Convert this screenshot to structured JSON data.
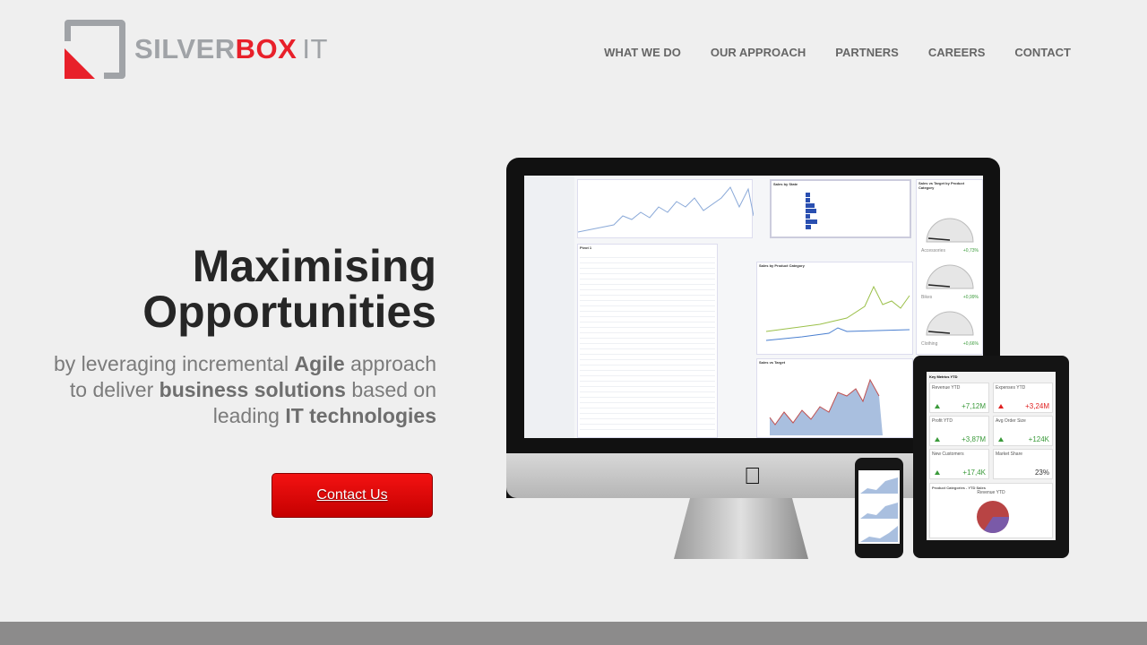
{
  "brand": {
    "name_a": "SILVER",
    "name_b": "BOX",
    "name_c": "IT",
    "accent": "#e8202a",
    "gray": "#a0a3a7"
  },
  "nav": [
    {
      "label": "WHAT WE DO"
    },
    {
      "label": "OUR APPROACH"
    },
    {
      "label": "PARTNERS"
    },
    {
      "label": "CAREERS"
    },
    {
      "label": "CONTACT"
    }
  ],
  "hero": {
    "title_1": "Maximising",
    "title_2": "Opportunities",
    "sub": [
      {
        "t": "by leveraging incremental ",
        "b": false
      },
      {
        "t": "Agile",
        "b": true
      },
      {
        "t": " approach to deliver ",
        "b": false
      },
      {
        "t": "business solutions",
        "b": true
      },
      {
        "t": " based on leading ",
        "b": false
      },
      {
        "t": "IT technologies",
        "b": true
      }
    ],
    "cta": "Contact Us"
  },
  "dashboard": {
    "sales_by_state": "Sales by State",
    "sales_by_category": "Sales by Product Category",
    "sales_vs_target": "Sales vs Target",
    "gauges_title": "Sales vs Target by Product Category",
    "pivot": "Pivot 1",
    "gauges": [
      {
        "label": "Accessories",
        "delta": "+0,73%"
      },
      {
        "label": "Bikes",
        "delta": "+0,99%"
      },
      {
        "label": "Clothing",
        "delta": "+0,66%"
      }
    ]
  },
  "tablet": {
    "title": "Key Metrics YTD",
    "tiles": [
      {
        "label": "Revenue YTD",
        "value": "+7,12M",
        "color": "#3a9a3a"
      },
      {
        "label": "Expenses YTD",
        "value": "+3,24M",
        "color": "#e02020"
      },
      {
        "label": "Profit YTD",
        "value": "+3,87M",
        "color": "#3a9a3a"
      },
      {
        "label": "Avg Order Size",
        "value": "+124K",
        "color": "#3a9a3a"
      },
      {
        "label": "New Customers",
        "value": "+17,4K",
        "color": "#3a9a3a"
      },
      {
        "label": "Market Share",
        "value": "23%",
        "color": "#333"
      }
    ],
    "pie_section": "Product Categories - YTD Sales",
    "pie_title": "Revenue YTD"
  }
}
